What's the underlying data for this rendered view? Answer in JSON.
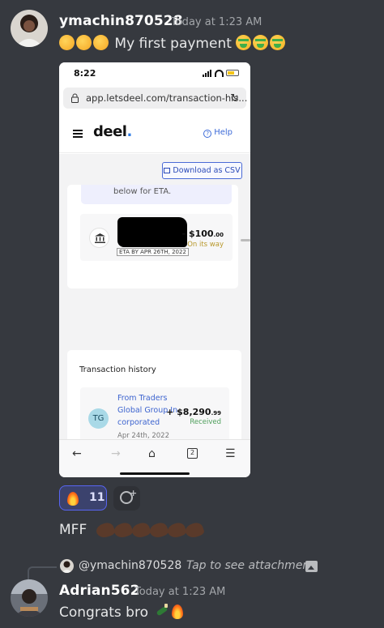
{
  "message1": {
    "username": "ymachin870528",
    "timestamp": "Today at 1:23 AM",
    "text": "My first payment",
    "attachment": {
      "status_time": "8:22",
      "url": "app.letsdeel.com/transaction-his...",
      "logo": "deel",
      "help_label": "Help",
      "csv_button": "Download as CSV",
      "eta_banner_text": "below for ETA.",
      "pending_payment": {
        "eta_tag": "ETA BY APR 26TH, 2022",
        "amount": "- $100",
        "amount_cents": ".00",
        "status": "On its way"
      },
      "history_title": "Transaction history",
      "transaction": {
        "initials": "TG",
        "name": "From Traders Global Group In-corporated",
        "date": "Apr 24th, 2022",
        "amount": "+ $8,290",
        "amount_cents": ".99",
        "status": "Received"
      },
      "tabs_count": "2"
    }
  },
  "reaction": {
    "icon": "fire-icon",
    "count": "11"
  },
  "message2_text": "MFF",
  "reply": {
    "mention": "@ymachin870528",
    "hint": "Tap to see attachment"
  },
  "message3": {
    "username": "Adrian562",
    "timestamp": "Today at 1:23 AM",
    "text": "Congrats bro"
  },
  "colors": {
    "background": "#36393f",
    "reaction_bg": "#3b426d",
    "reaction_border": "#5865f2",
    "deel_link": "#3d64cf",
    "received_green": "#4d9e5a"
  }
}
